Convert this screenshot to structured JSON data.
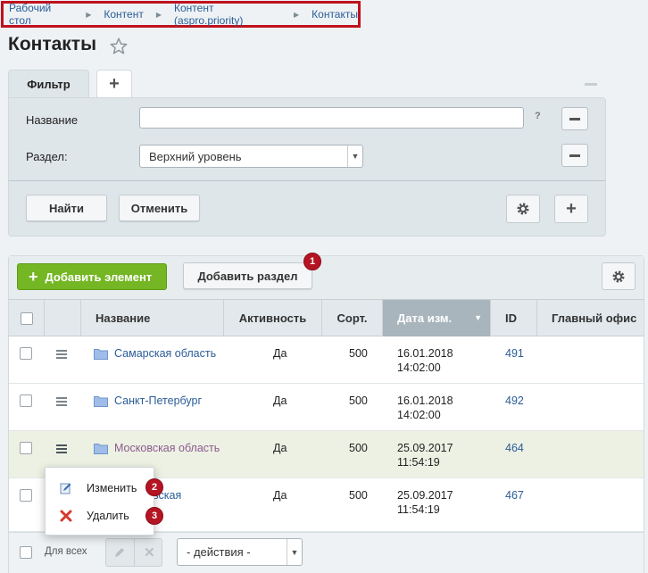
{
  "breadcrumb": [
    "Рабочий стол",
    "Контент",
    "Контент (aspro.priority)",
    "Контакты"
  ],
  "page_title": "Контакты",
  "filter": {
    "tab_label": "Фильтр",
    "add_tab_symbol": "+",
    "fields": {
      "name_label": "Название",
      "name_value": "",
      "help_mark": "?",
      "section_label": "Раздел:",
      "section_value": "Верхний уровень"
    },
    "find_button": "Найти",
    "cancel_button": "Отменить"
  },
  "toolbar": {
    "add_element": "Добавить элемент",
    "add_section": "Добавить раздел",
    "badge_1": "1"
  },
  "table": {
    "columns": [
      "Название",
      "Активность",
      "Сорт.",
      "Дата изм.",
      "ID",
      "Главный офис"
    ],
    "sorted_column": "Дата изм.",
    "rows": [
      {
        "name": "Самарская область",
        "active": "Да",
        "sort": "500",
        "date": "16.01.2018",
        "time": "14:02:00",
        "id": "491",
        "main_office": ""
      },
      {
        "name": "Санкт-Петербург",
        "active": "Да",
        "sort": "500",
        "date": "16.01.2018",
        "time": "14:02:00",
        "id": "492",
        "main_office": ""
      },
      {
        "name": "Московская область",
        "active": "Да",
        "sort": "500",
        "date": "25.09.2017",
        "time": "11:54:19",
        "id": "464",
        "main_office": ""
      },
      {
        "name": "вская",
        "active": "Да",
        "sort": "500",
        "date": "25.09.2017",
        "time": "11:54:19",
        "id": "467",
        "main_office": ""
      }
    ]
  },
  "context_menu": {
    "edit": "Изменить",
    "delete": "Удалить",
    "badge_2": "2",
    "badge_3": "3"
  },
  "footer": {
    "for_all": "Для всех",
    "actions_select": "- действия -"
  },
  "colors": {
    "breadcrumb_highlight": "#c0111f",
    "add_button": "#74b623",
    "badge": "#b51423",
    "link": "#2b5c99",
    "sorted_header": "#a9b5bc",
    "highlight_row": "#edf1e3"
  },
  "icons": [
    "star-icon",
    "plus-icon",
    "minus-icon",
    "gear-icon",
    "hamburger-menu-icon",
    "folder-icon",
    "pencil-icon",
    "cross-icon",
    "sort-down-icon",
    "chevron-down-icon"
  ]
}
